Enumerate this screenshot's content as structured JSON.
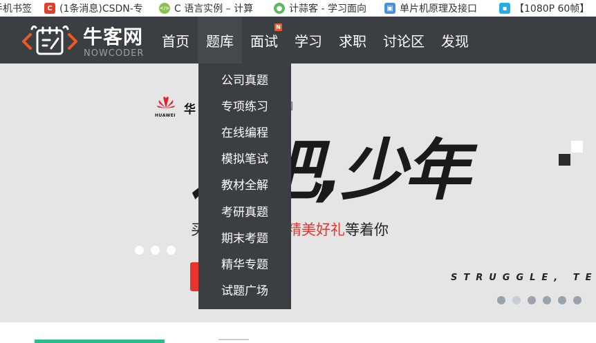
{
  "bookmarks": [
    {
      "label": "手机书签",
      "icon": "folder-icon",
      "color": "#ffffff"
    },
    {
      "label": "(1条消息)CSDN-专",
      "icon": "csdn-icon",
      "color": "#e33e2b"
    },
    {
      "label": "C 语言实例 – 计算",
      "icon": "runoob-icon",
      "color": "#8bc34a"
    },
    {
      "label": "计蒜客 - 学习面向",
      "icon": "jisuanke-icon",
      "color": "#5cb85c"
    },
    {
      "label": "单片机原理及接口",
      "icon": "cube-icon",
      "color": "#4a90d9"
    },
    {
      "label": "【1080P 60帧】",
      "icon": "bilibili-icon",
      "color": "#23ade5"
    }
  ],
  "logo": {
    "cn": "牛客网",
    "en": "NOWCODER",
    "accent": "#f05a22"
  },
  "nav": {
    "items": [
      {
        "label": "首页"
      },
      {
        "label": "题库"
      },
      {
        "label": "面试",
        "badge": "N"
      },
      {
        "label": "学习"
      },
      {
        "label": "求职"
      },
      {
        "label": "讨论区"
      },
      {
        "label": "发现"
      }
    ]
  },
  "dropdown": {
    "items": [
      "公司真题",
      "专项练习",
      "在线编程",
      "模拟笔试",
      "教材全解",
      "考研真题",
      "期末考题",
      "精华专题",
      "试题广场"
    ]
  },
  "banner": {
    "partner_brand": "HUAWEI",
    "partner_text": "华",
    "partner_text_right": "网",
    "slogan": "进吧,少年",
    "sub_left": "买",
    "sub_red": "精美好礼",
    "sub_right": "等着你",
    "tagline": "STRUGGLE, TEE"
  }
}
